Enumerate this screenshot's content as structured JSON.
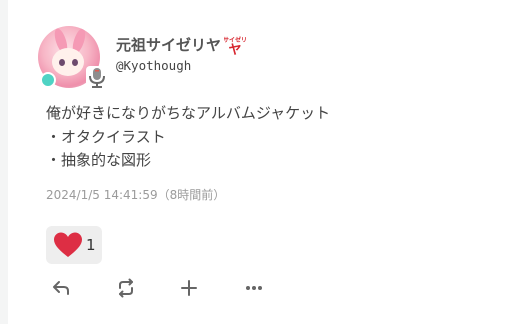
{
  "user": {
    "display_name": "元祖サイゼリヤ",
    "name_emoji_text": "サイゼリヤ",
    "handle": "@Kyothough"
  },
  "note": {
    "lines": [
      "俺が好きになりがちなアルバムジャケット",
      "・オタクイラスト",
      "・抽象的な図形"
    ],
    "timestamp": "2024/1/5 14:41:59（8時間前）"
  },
  "reactions": [
    {
      "emoji": "heart-icon",
      "count": "1"
    }
  ],
  "actions": [
    "reply-icon",
    "renote-icon",
    "add-reaction-icon",
    "more-icon"
  ],
  "colors": {
    "online": "#4fd3c4",
    "heart": "#dd2e44",
    "text": "#444444",
    "muted": "#9b9b9b"
  }
}
